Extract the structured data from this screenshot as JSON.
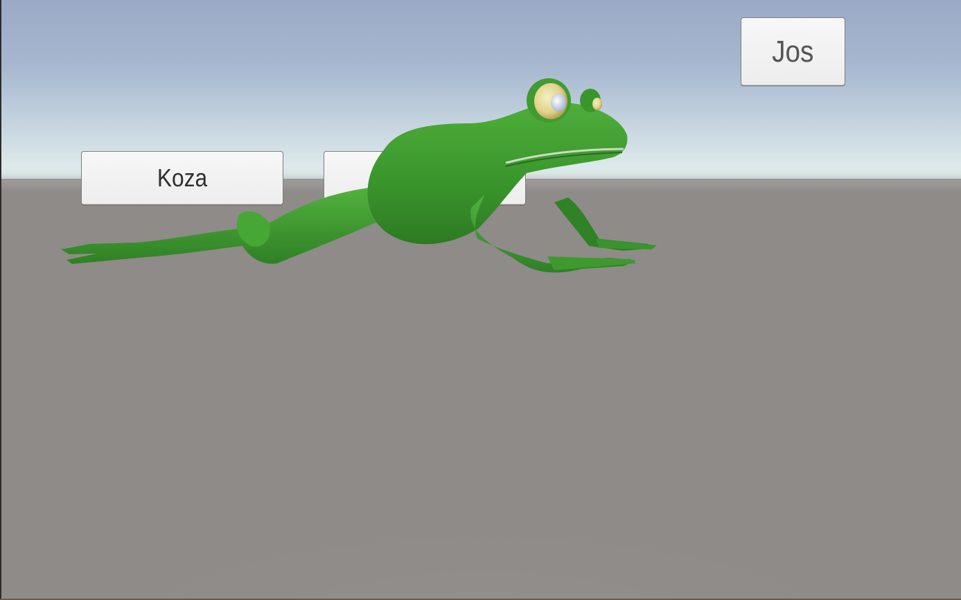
{
  "scene": {
    "sky_colors": [
      "#9aaac6",
      "#dde9ea"
    ],
    "ground_color": "#8f8b89",
    "frog_color": "#3f9a2f"
  },
  "buttons": {
    "koza": "Koza",
    "jos": "Jos",
    "hidden": ""
  }
}
